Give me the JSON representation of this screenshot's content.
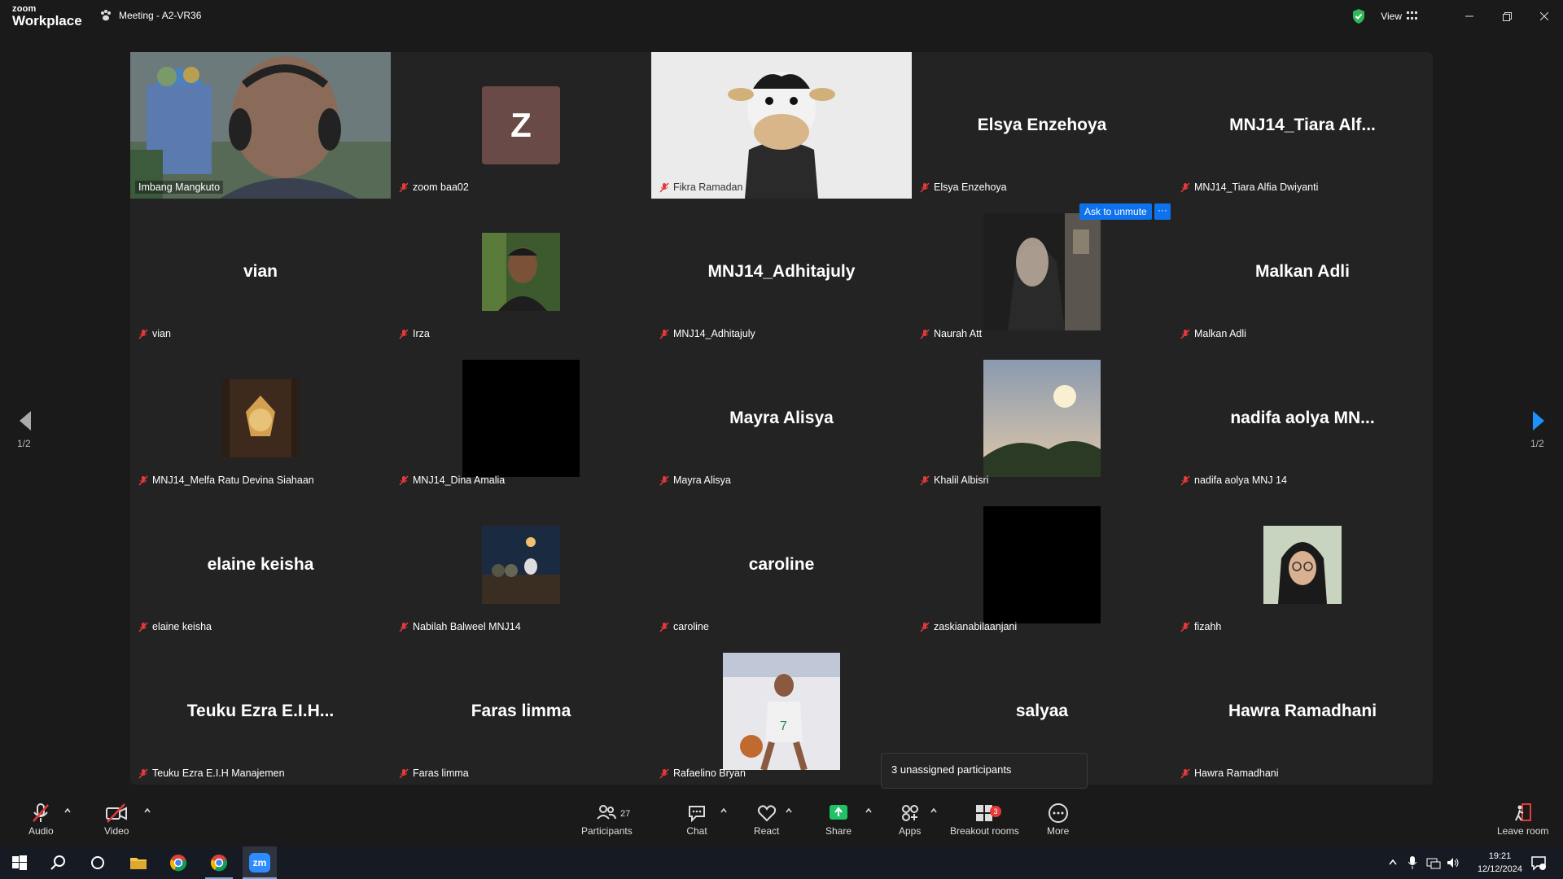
{
  "app": {
    "logo_line1": "zoom",
    "logo_line2": "Workplace",
    "meeting_title": "Meeting - A2-VR36",
    "view_label": "View"
  },
  "colors": {
    "active_speaker": "#2fd05b",
    "accent_blue": "#0e72ed",
    "mute_red": "#e5393a",
    "share_green": "#1fc264"
  },
  "tiles": [
    {
      "label": "Imbang Mangkuto",
      "display": "video",
      "muted": false,
      "active": true
    },
    {
      "label": "zoom baa02",
      "display": "initial",
      "initial": "Z",
      "muted": true
    },
    {
      "label": "Fikra Ramadan",
      "display": "cow-avatar",
      "muted": true
    },
    {
      "label": "Elsya Enzehoya",
      "display": "name",
      "name": "Elsya Enzehoya",
      "muted": true
    },
    {
      "label": "MNJ14_Tiara Alfia Dwiyanti",
      "display": "name",
      "name": "MNJ14_Tiara  Alf...",
      "muted": true
    },
    {
      "label": "vian",
      "display": "name",
      "name": "vian",
      "muted": true
    },
    {
      "label": "Irza",
      "display": "photo",
      "muted": true
    },
    {
      "label": "MNJ14_Adhitajuly",
      "display": "name",
      "name": "MNJ14_Adhitajuly",
      "muted": true
    },
    {
      "label": "Naurah Att",
      "display": "photo",
      "muted": true
    },
    {
      "label": "Malkan Adli",
      "display": "name",
      "name": "Malkan Adli",
      "muted": true
    },
    {
      "label": "MNJ14_Melfa Ratu Devina Siahaan",
      "display": "photo",
      "muted": true
    },
    {
      "label": "MNJ14_Dina Amalia",
      "display": "black",
      "muted": true
    },
    {
      "label": "Mayra Alisya",
      "display": "name",
      "name": "Mayra Alisya",
      "muted": true
    },
    {
      "label": "Khalil Albisri",
      "display": "photo",
      "muted": true
    },
    {
      "label": "nadifa aolya MNJ 14",
      "display": "name",
      "name": "nadifa  aolya  MN...",
      "muted": true
    },
    {
      "label": "elaine keisha",
      "display": "name",
      "name": "elaine keisha",
      "muted": true
    },
    {
      "label": "Nabilah Balweel MNJ14",
      "display": "photo",
      "muted": true
    },
    {
      "label": "caroline",
      "display": "name",
      "name": "caroline",
      "muted": true
    },
    {
      "label": "zaskianabilaanjani",
      "display": "black",
      "muted": true
    },
    {
      "label": "fizahh",
      "display": "photo",
      "muted": true
    },
    {
      "label": "Teuku Ezra E.I.H Manajemen",
      "display": "name",
      "name": "Teuku Ezra E.I.H...",
      "muted": true
    },
    {
      "label": "Faras limma",
      "display": "name",
      "name": "Faras limma",
      "muted": true
    },
    {
      "label": "Rafaelino Bryan",
      "display": "photo",
      "muted": true
    },
    {
      "label": "salyaa",
      "display": "name",
      "name": "salyaa",
      "muted": true
    },
    {
      "label": "Hawra Ramadhani",
      "display": "name",
      "name": "Hawra Ramadhani",
      "muted": true
    }
  ],
  "pagination": {
    "left": "1/2",
    "right": "1/2"
  },
  "popups": {
    "ask_to_unmute": "Ask to unmute",
    "more": "···",
    "unassigned": "3 unassigned participants"
  },
  "toolbar": {
    "audio": "Audio",
    "video": "Video",
    "participants": "Participants",
    "participants_count": "27",
    "chat": "Chat",
    "react": "React",
    "share": "Share",
    "apps": "Apps",
    "breakout": "Breakout rooms",
    "breakout_badge": "3",
    "more": "More",
    "leave": "Leave room"
  },
  "taskbar": {
    "time": "19:21",
    "date": "12/12/2024",
    "zoom_label": "zm"
  }
}
